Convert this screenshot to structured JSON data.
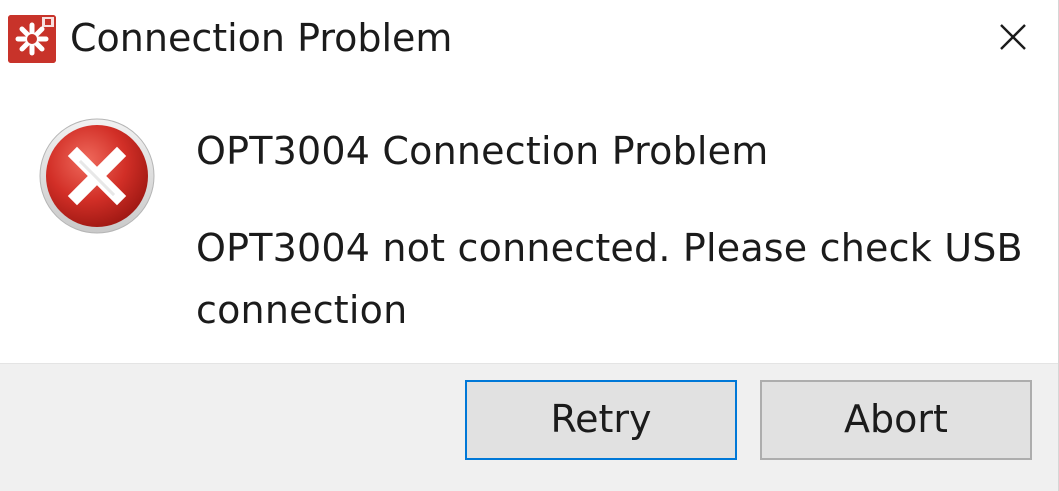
{
  "window": {
    "title": "Connection Problem",
    "app_icon": "app-logo-icon",
    "close_icon": "close-icon"
  },
  "content": {
    "icon": "error-icon",
    "heading": "OPT3004 Connection Problem",
    "message": "OPT3004 not connected. Please check USB connection"
  },
  "buttons": {
    "retry_label": "Retry",
    "abort_label": "Abort"
  },
  "colors": {
    "error_red": "#d22f27",
    "focus_blue": "#0078d7",
    "footer_bg": "#f0f0f0"
  }
}
